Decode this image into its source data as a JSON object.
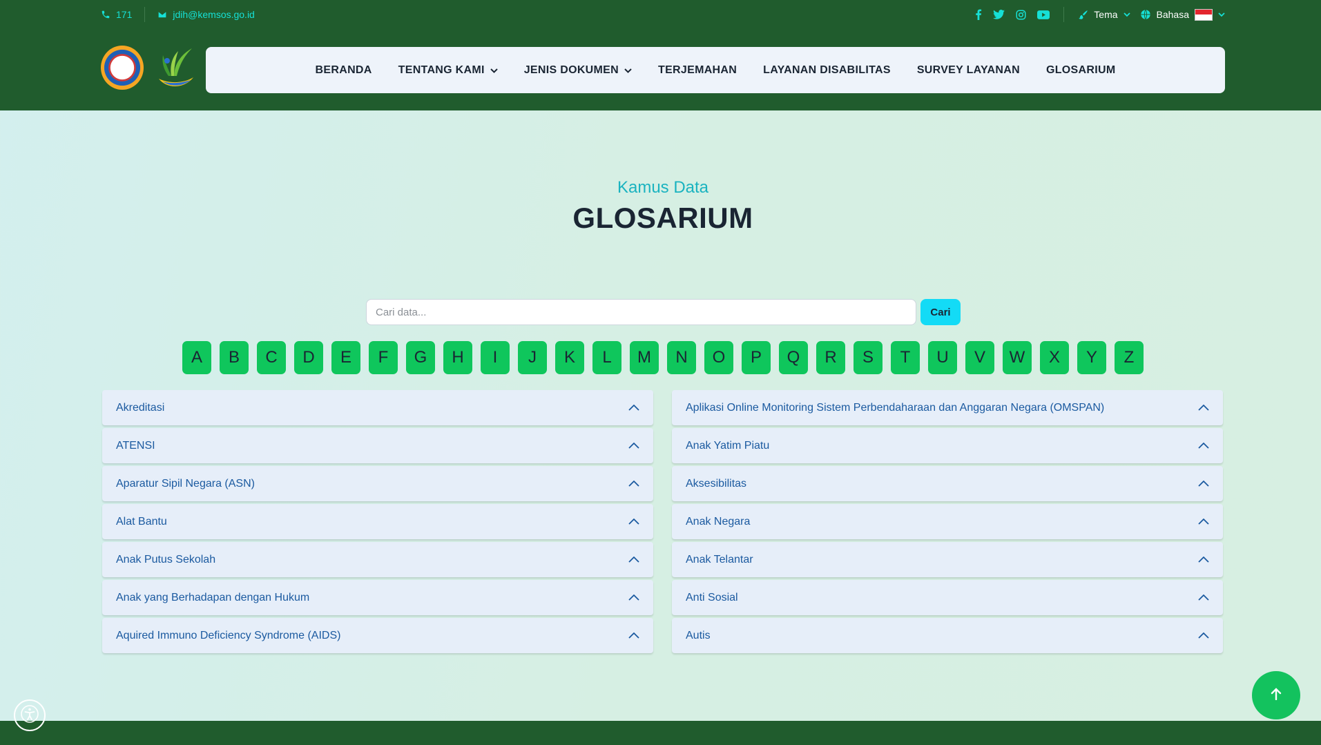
{
  "topbar": {
    "phone": "171",
    "email": "jdih@kemsos.go.id",
    "tema_label": "Tema",
    "bahasa_label": "Bahasa"
  },
  "nav": {
    "items": [
      {
        "label": "BERANDA",
        "dropdown": false
      },
      {
        "label": "TENTANG KAMI",
        "dropdown": true
      },
      {
        "label": "JENIS DOKUMEN",
        "dropdown": true
      },
      {
        "label": "TERJEMAHAN",
        "dropdown": false
      },
      {
        "label": "LAYANAN DISABILITAS",
        "dropdown": false
      },
      {
        "label": "SURVEY LAYANAN",
        "dropdown": false
      },
      {
        "label": "GLOSARIUM",
        "dropdown": false
      }
    ]
  },
  "hero": {
    "subtitle": "Kamus Data",
    "title": "GLOSARIUM"
  },
  "search": {
    "placeholder": "Cari data...",
    "value": "",
    "button_label": "Cari"
  },
  "alphabet": [
    "A",
    "B",
    "C",
    "D",
    "E",
    "F",
    "G",
    "H",
    "I",
    "J",
    "K",
    "L",
    "M",
    "N",
    "O",
    "P",
    "Q",
    "R",
    "S",
    "T",
    "U",
    "V",
    "W",
    "X",
    "Y",
    "Z"
  ],
  "glossary": {
    "left": [
      "Akreditasi",
      "ATENSI",
      "Aparatur Sipil Negara (ASN)",
      "Alat Bantu",
      "Anak Putus Sekolah",
      "Anak yang Berhadapan dengan Hukum",
      "Aquired Immuno Deficiency Syndrome (AIDS)"
    ],
    "right": [
      "Aplikasi Online Monitoring Sistem Perbendaharaan dan Anggaran Negara (OMSPAN)",
      "Anak Yatim Piatu",
      "Aksesibilitas",
      "Anak Negara",
      "Anak Telantar",
      "Anti Sosial",
      "Autis"
    ]
  },
  "colors": {
    "header_bg": "#205c2d",
    "accent_teal": "#16e0d6",
    "letter_green": "#0fc65c",
    "search_button": "#13dbf6",
    "accordion_text": "#1b5aa0"
  },
  "icons": [
    "phone-icon",
    "mail-icon",
    "facebook-icon",
    "twitter-icon",
    "instagram-icon",
    "youtube-icon",
    "brush-icon",
    "globe-icon",
    "chevron-down-icon",
    "chevron-up-icon",
    "arrow-up-icon",
    "accessibility-icon",
    "indonesia-flag-icon"
  ]
}
